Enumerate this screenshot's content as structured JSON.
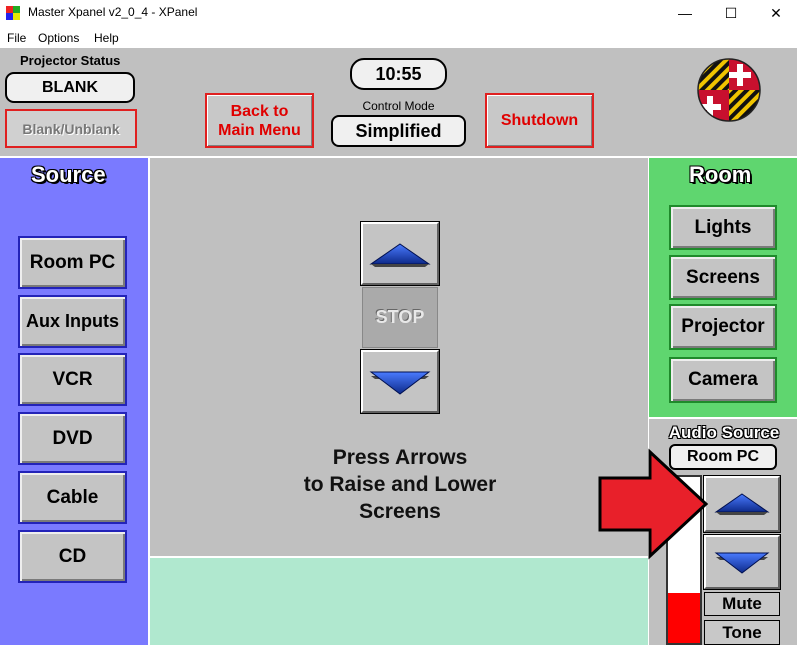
{
  "window": {
    "title": "Master Xpanel v2_0_4 - XPanel",
    "minimize_glyph": "—",
    "maximize_glyph": "☐",
    "close_glyph": "✕"
  },
  "menu": [
    "File",
    "Options",
    "Help"
  ],
  "header": {
    "projector_status_label": "Projector Status",
    "projector_status_value": "BLANK",
    "blank_unblank": "Blank/Unblank",
    "back_line1": "Back to",
    "back_line2": "Main Menu",
    "time": "10:55",
    "control_mode_label": "Control Mode",
    "control_mode_value": "Simplified",
    "shutdown": "Shutdown"
  },
  "source": {
    "title": "Source",
    "items": [
      "Room PC",
      "Aux Inputs",
      "VCR",
      "DVD",
      "Cable",
      "CD"
    ]
  },
  "center": {
    "stop_label": "STOP",
    "instructions": [
      "Press Arrows",
      "to Raise and Lower",
      "Screens"
    ]
  },
  "room": {
    "title": "Room",
    "items": [
      "Lights",
      "Screens",
      "Projector",
      "Camera"
    ]
  },
  "audio": {
    "title": "Audio Source",
    "current": "Room PC",
    "mute": "Mute",
    "tone": "Tone",
    "level": 0.3
  },
  "colors": {
    "source_bg": "#7a7aff",
    "room_bg": "#5fd66f",
    "center_bg": "#c0c0c0",
    "bottom_bg": "#b0e8cf",
    "accent_red": "#e00000",
    "arrow_blue": "#1a3fb0"
  },
  "icons": {
    "up_arrow": "up-triangle-icon",
    "down_arrow": "down-triangle-icon",
    "pointer": "red-arrow-icon",
    "logo": "maryland-flag-logo"
  }
}
